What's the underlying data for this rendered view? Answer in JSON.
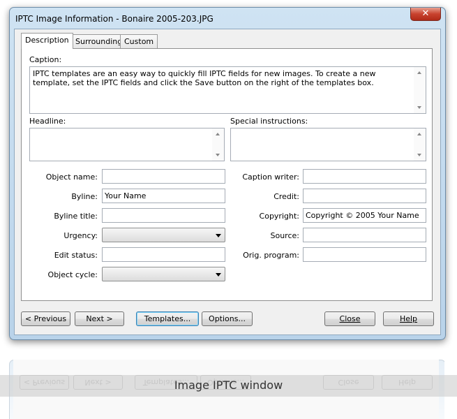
{
  "window": {
    "title": "IPTC Image Information - Bonaire 2005-203.JPG",
    "close_glyph": "✕"
  },
  "tabs": [
    {
      "label": "Description",
      "active": true
    },
    {
      "label": "Surroundings",
      "active": false
    },
    {
      "label": "Custom",
      "active": false
    }
  ],
  "caption": {
    "label": "Caption:",
    "value": "IPTC templates are an easy way to quickly fill IPTC fields for new images. To create a new template, set the IPTC fields and click the Save button on the right of the templates box."
  },
  "headline": {
    "label": "Headline:",
    "value": ""
  },
  "special_instructions": {
    "label": "Special instructions:",
    "value": ""
  },
  "left_fields": {
    "object_name": {
      "label": "Object name:",
      "value": ""
    },
    "byline": {
      "label": "Byline:",
      "value": "Your Name"
    },
    "byline_title": {
      "label": "Byline title:",
      "value": ""
    },
    "urgency": {
      "label": "Urgency:",
      "value": ""
    },
    "edit_status": {
      "label": "Edit status:",
      "value": ""
    },
    "object_cycle": {
      "label": "Object cycle:",
      "value": ""
    }
  },
  "right_fields": {
    "caption_writer": {
      "label": "Caption writer:",
      "value": ""
    },
    "credit": {
      "label": "Credit:",
      "value": ""
    },
    "copyright": {
      "label": "Copyright:",
      "value": "Copyright © 2005 Your Name"
    },
    "source": {
      "label": "Source:",
      "value": ""
    },
    "orig_program": {
      "label": "Orig. program:",
      "value": ""
    }
  },
  "buttons": {
    "previous": "< Previous",
    "next": "Next >",
    "templates": "Templates...",
    "options": "Options...",
    "close": "Close",
    "help": "Help"
  },
  "image_caption": "Image IPTC window"
}
